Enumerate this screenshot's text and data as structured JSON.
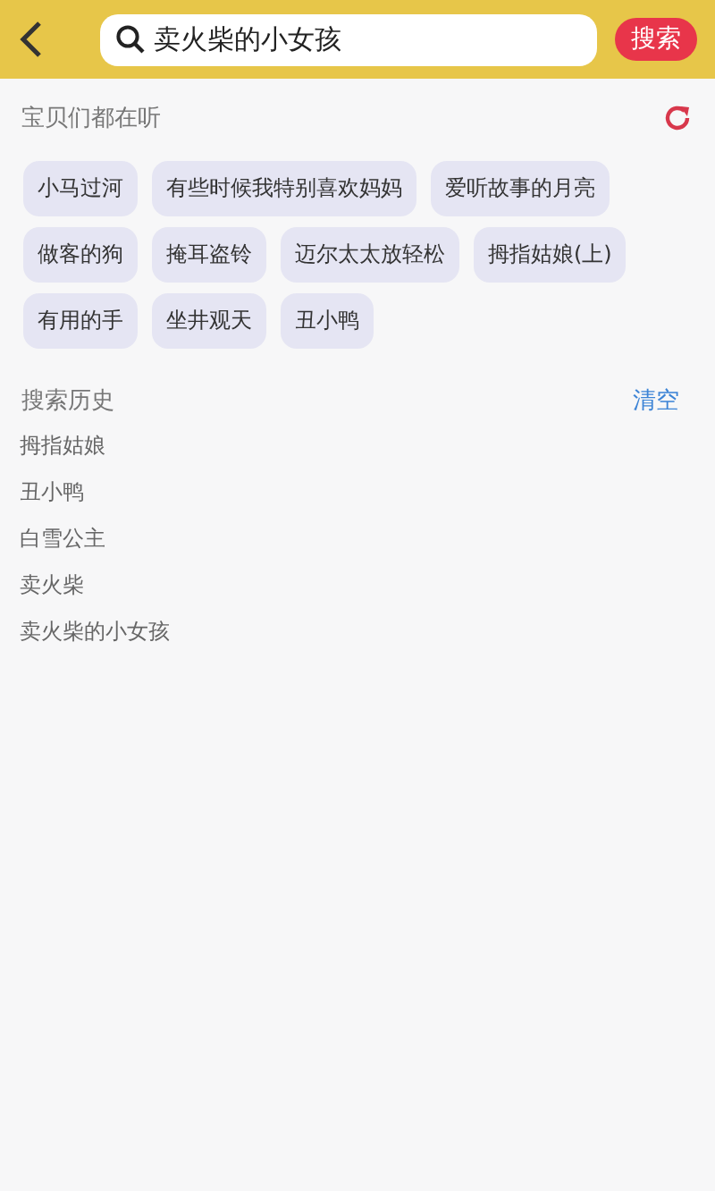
{
  "search": {
    "value": "卖火柴的小女孩",
    "button": "搜索"
  },
  "popular": {
    "title": "宝贝们都在听",
    "tags": [
      "小马过河",
      "有些时候我特别喜欢妈妈",
      "爱听故事的月亮",
      "做客的狗",
      "掩耳盗铃",
      "迈尔太太放轻松",
      "拇指姑娘(上)",
      "有用的手",
      "坐井观天",
      "丑小鸭"
    ]
  },
  "history": {
    "title": "搜索历史",
    "clear": "清空",
    "items": [
      "拇指姑娘",
      "丑小鸭",
      "白雪公主",
      "卖火柴",
      "卖火柴的小女孩"
    ]
  }
}
